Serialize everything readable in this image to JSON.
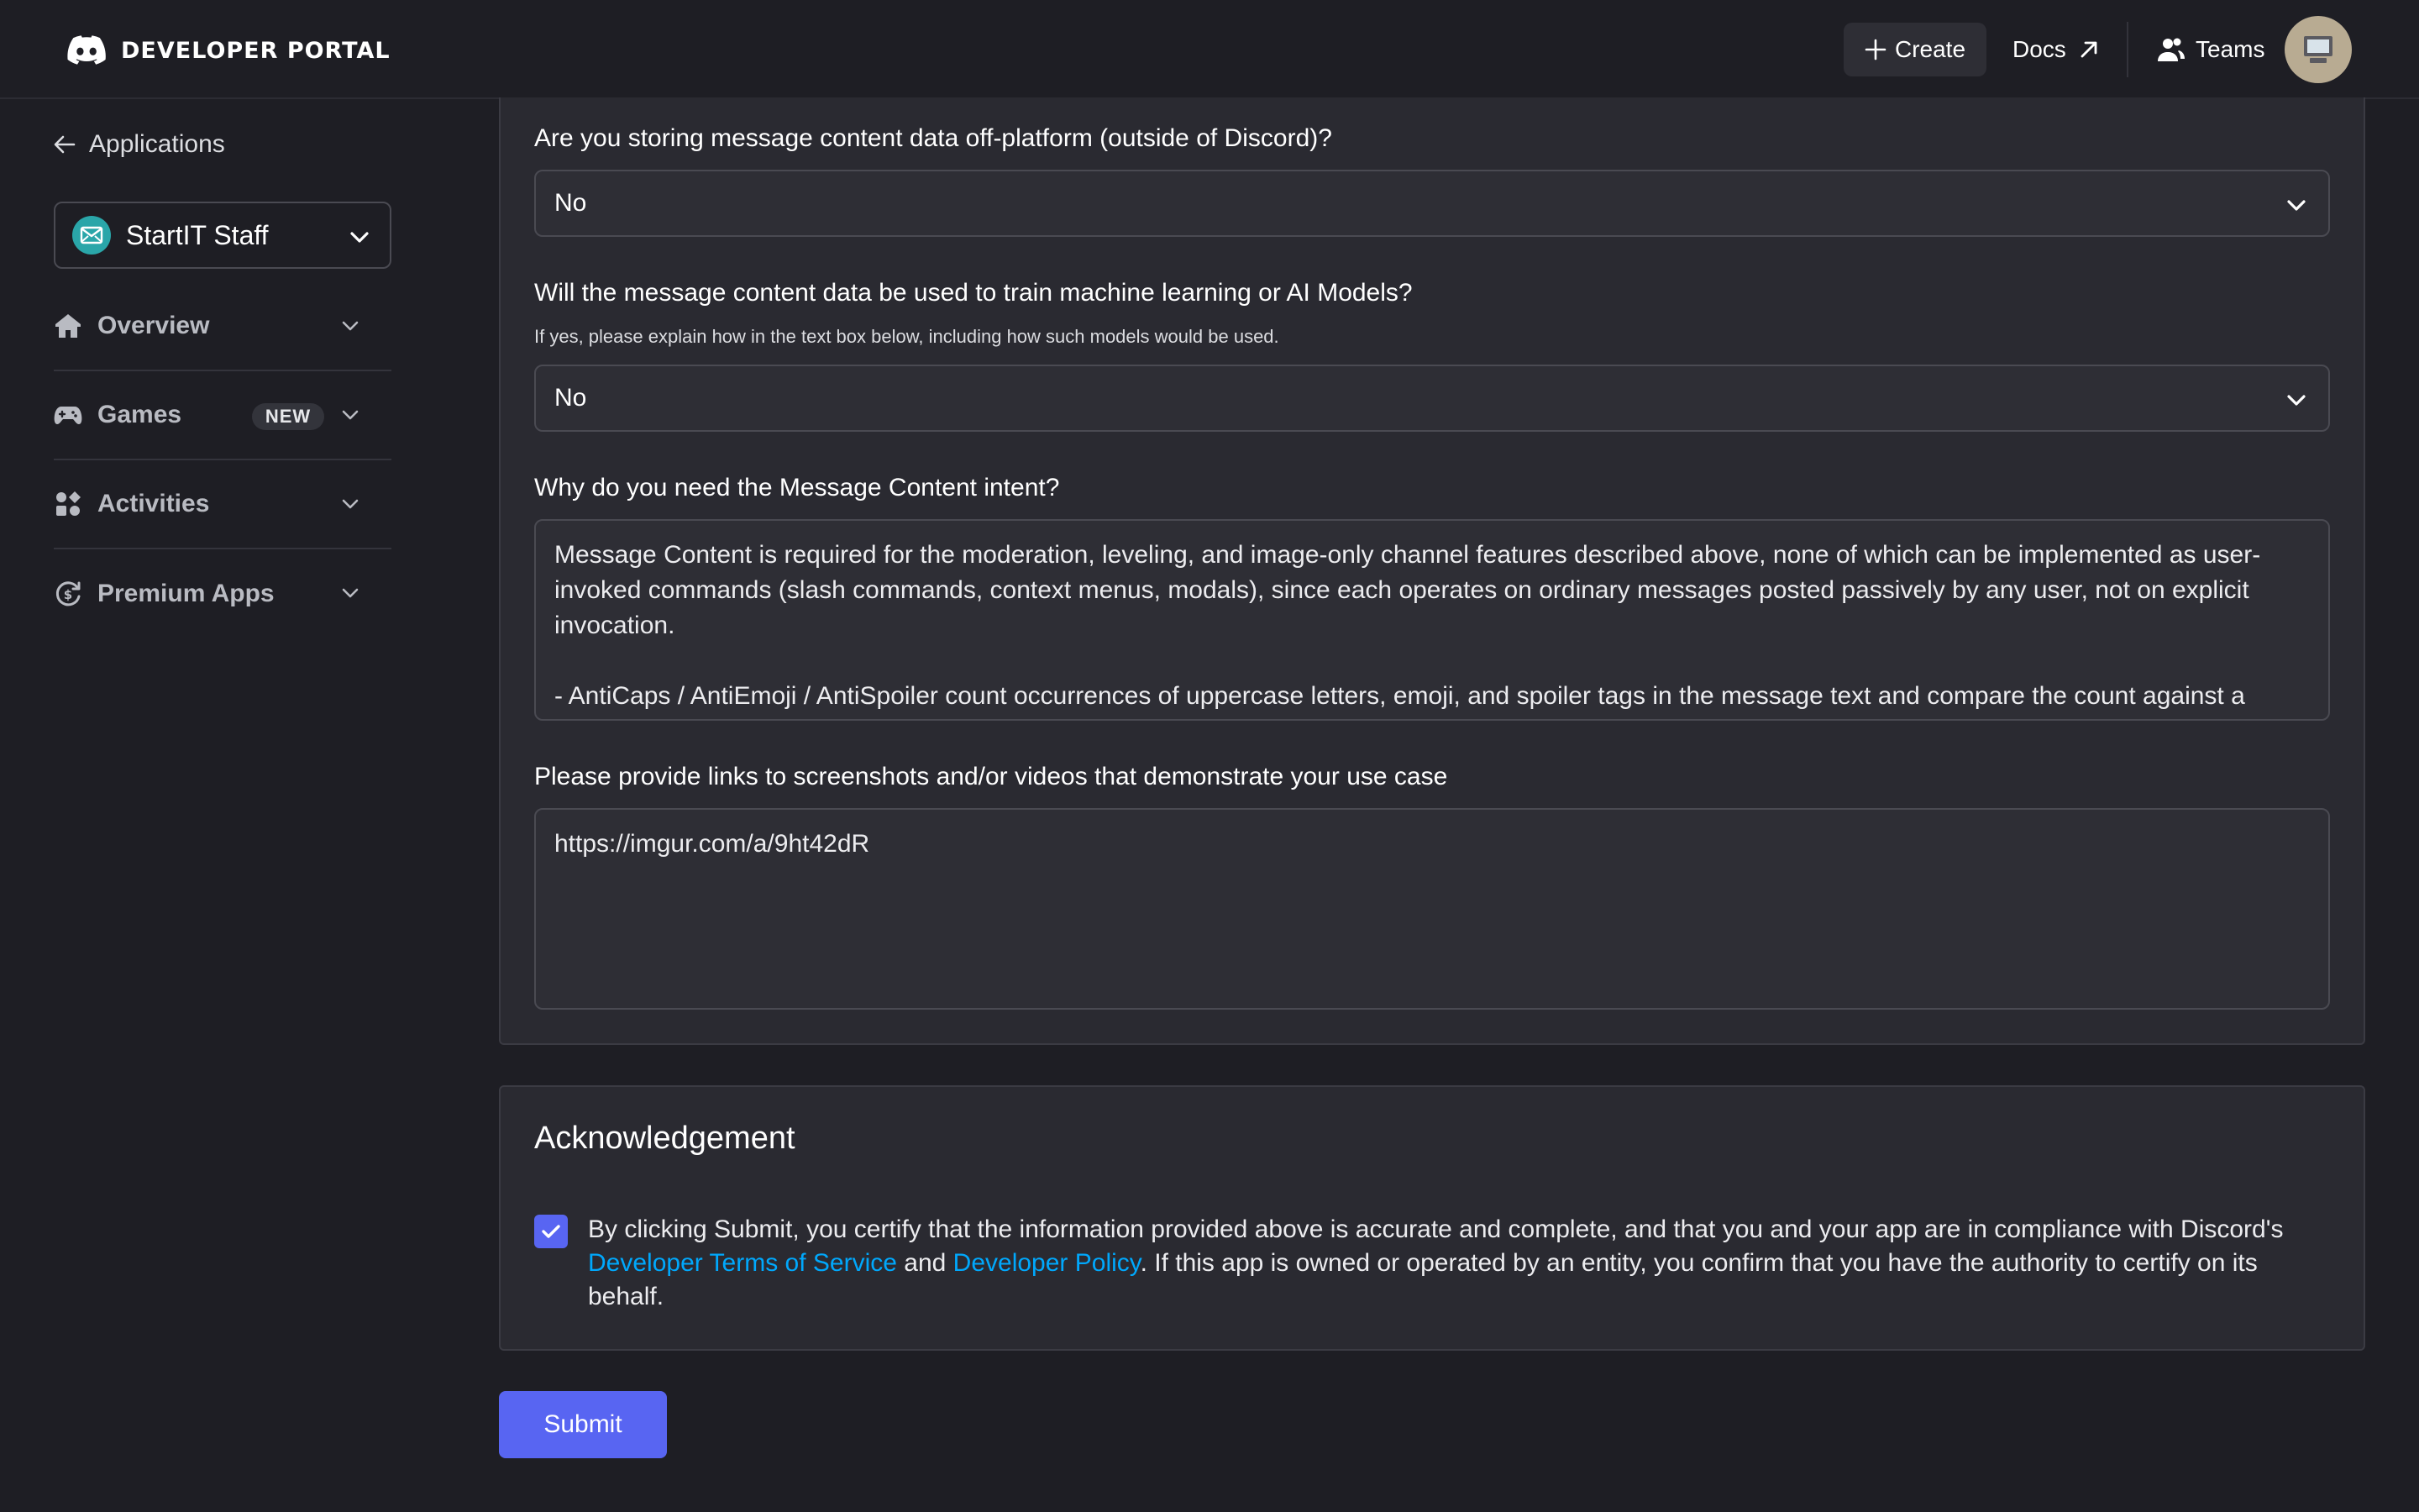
{
  "header": {
    "brand": "DEVELOPER PORTAL",
    "create_label": "Create",
    "docs_label": "Docs",
    "teams_label": "Teams"
  },
  "sidebar": {
    "back_label": "Applications",
    "app_name": "StartIT Staff",
    "items": [
      {
        "label": "Overview",
        "icon": "home-icon"
      },
      {
        "label": "Games",
        "icon": "gamepad-icon",
        "badge": "NEW"
      },
      {
        "label": "Activities",
        "icon": "activities-icon"
      },
      {
        "label": "Premium Apps",
        "icon": "premium-icon"
      }
    ]
  },
  "form": {
    "q_offplatform": "Are you storing message content data off-platform (outside of Discord)?",
    "q_offplatform_value": "No",
    "q_ml": "Will the message content data be used to train machine learning or AI Models?",
    "q_ml_help": "If yes, please explain how in the text box below, including how such models would be used.",
    "q_ml_value": "No",
    "q_why": "Why do you need the Message Content intent?",
    "q_why_value_p1": "Message Content is required for the moderation, leveling, and image-only channel features described above, none of which can be implemented as user-invoked commands (slash commands, context menus, modals), since each operates on ordinary messages posted passively by any user, not on explicit invocation.",
    "q_why_value_p2": " - AntiCaps / AntiEmoji / AntiSpoiler count occurrences of uppercase letters, emoji, and spoiler tags in the message text and compare the count against a",
    "q_links": "Please provide links to screenshots and/or videos that demonstrate your use case",
    "q_links_value": "https://imgur.com/a/9ht42dR"
  },
  "ack": {
    "title": "Acknowledgement",
    "checked": true,
    "text_1": "By clicking Submit, you certify that the information provided above is accurate and complete, and that you and your app are in compliance with Discord's ",
    "link_tos": "Developer Terms of Service",
    "text_2": " and ",
    "link_policy": "Developer Policy",
    "text_3": ". If this app is owned or operated by an entity, you confirm that you have the authority to certify on its behalf."
  },
  "submit_label": "Submit",
  "colors": {
    "background": "#1e1e24",
    "panel": "#2a2a31",
    "accent": "#5865f2",
    "link": "#00a8fc"
  }
}
